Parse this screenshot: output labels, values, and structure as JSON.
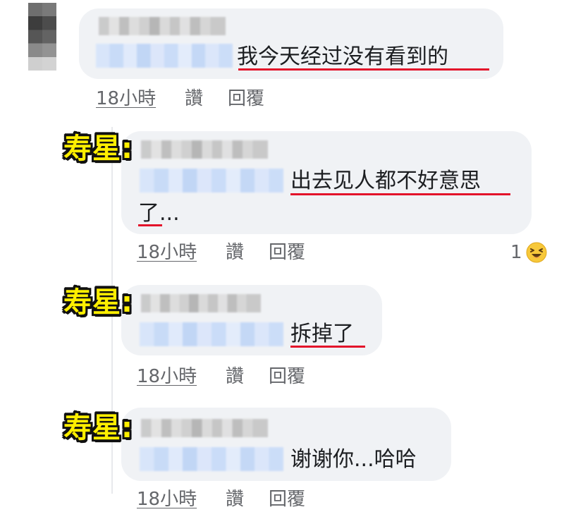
{
  "comments": [
    {
      "id": "c1",
      "label": "",
      "text": "我今天经过没有看到的",
      "time": "18小時",
      "like": "讚",
      "reply": "回覆"
    },
    {
      "id": "c2",
      "label": "寿星:",
      "text_line1": "出去见人都不好意思",
      "text_line2": "了...",
      "time": "18小時",
      "like": "讚",
      "reply": "回覆",
      "reaction_count": "1",
      "reaction_icon": "laughing-emoji-icon"
    },
    {
      "id": "c3",
      "label": "寿星:",
      "text": "拆掉了",
      "time": "18小時",
      "like": "讚",
      "reply": "回覆"
    },
    {
      "id": "c4",
      "label": "寿星:",
      "text": "谢谢你...哈哈",
      "time": "18小時",
      "like": "讚",
      "reply": "回覆"
    }
  ],
  "colors": {
    "bubble": "#f0f2f5",
    "meta_text": "#65676b",
    "message_text": "#1c1e21",
    "underline": "#e3132a",
    "label_fill": "#ffef00",
    "label_stroke": "#111111"
  }
}
